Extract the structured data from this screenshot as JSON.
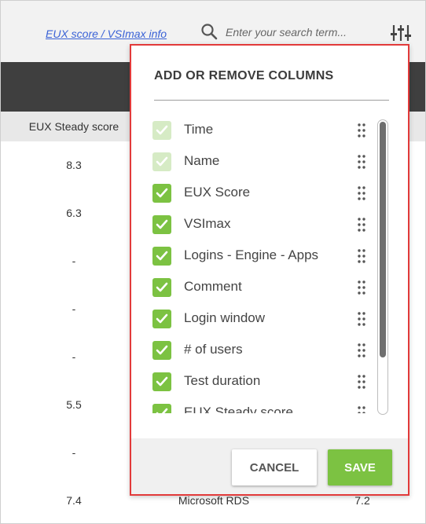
{
  "toolbar": {
    "info_link": "EUX score / VSImax info",
    "search_placeholder": "Enter your search term...",
    "search_icon": "search-icon",
    "settings_icon": "column-settings-icon"
  },
  "table": {
    "subheader_eux": "EUX Steady score",
    "rows": [
      {
        "eux": "8.3",
        "name": "",
        "vsimax": ""
      },
      {
        "eux": "6.3",
        "name": "",
        "vsimax": ""
      },
      {
        "eux": "-",
        "name": "",
        "vsimax": ""
      },
      {
        "eux": "-",
        "name": "",
        "vsimax": ""
      },
      {
        "eux": "-",
        "name": "",
        "vsimax": ""
      },
      {
        "eux": "5.5",
        "name": "",
        "vsimax": ""
      },
      {
        "eux": "-",
        "name": "",
        "vsimax": ""
      },
      {
        "eux": "7.4",
        "name": "Microsoft RDS",
        "vsimax": "7.2"
      }
    ]
  },
  "panel": {
    "title": "ADD OR REMOVE COLUMNS",
    "columns": [
      {
        "label": "Time",
        "checked": true,
        "locked": true
      },
      {
        "label": "Name",
        "checked": true,
        "locked": true
      },
      {
        "label": "EUX Score",
        "checked": true,
        "locked": false
      },
      {
        "label": "VSImax",
        "checked": true,
        "locked": false
      },
      {
        "label": "Logins - Engine - Apps",
        "checked": true,
        "locked": false
      },
      {
        "label": "Comment",
        "checked": true,
        "locked": false
      },
      {
        "label": "Login window",
        "checked": true,
        "locked": false
      },
      {
        "label": "# of users",
        "checked": true,
        "locked": false
      },
      {
        "label": "Test duration",
        "checked": true,
        "locked": false
      },
      {
        "label": "EUX Steady score",
        "checked": true,
        "locked": false
      }
    ],
    "cancel_label": "CANCEL",
    "save_label": "SAVE"
  },
  "colors": {
    "accent_green": "#7cc242",
    "disabled_green": "#d6ebc5",
    "highlight_red": "#e23a3a",
    "header_dark": "#3f3f3f"
  }
}
